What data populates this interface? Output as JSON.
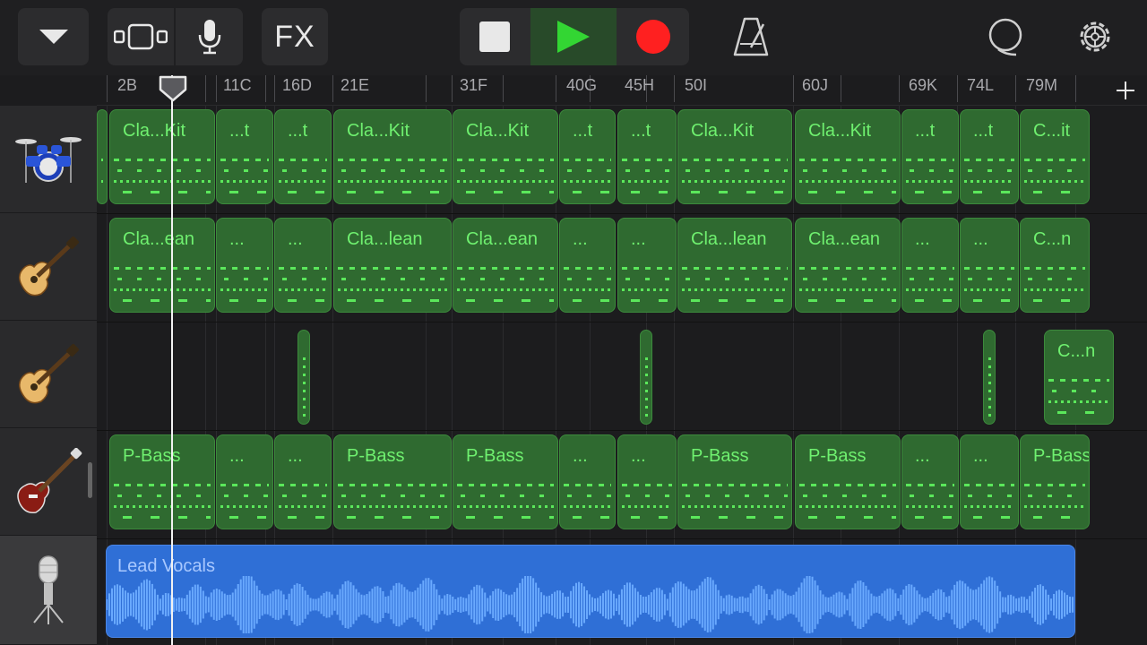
{
  "toolbar": {
    "fx_label": "FX",
    "icons": [
      "menu-down-icon",
      "tracks-view-icon",
      "microphone-icon",
      "stop-icon",
      "play-icon",
      "record-icon",
      "metronome-icon",
      "loop-browser-icon",
      "settings-gear-icon"
    ],
    "colors": {
      "play": "#33d633",
      "record": "#ff2020"
    }
  },
  "ruler": {
    "markers": [
      {
        "label": "2B"
      },
      {
        "label": "11C"
      },
      {
        "label": "16D"
      },
      {
        "label": "21E"
      },
      {
        "label": "31F"
      },
      {
        "label": "40G"
      },
      {
        "label": "45H"
      },
      {
        "label": "50I"
      },
      {
        "label": "60J"
      },
      {
        "label": "69K"
      },
      {
        "label": "74L"
      },
      {
        "label": "79M"
      }
    ]
  },
  "tracks": [
    {
      "instrument": "drum-kit-icon",
      "regions": [
        "Cla...Kit",
        "...t",
        "...t",
        "Cla...Kit",
        "Cla...Kit",
        "...t",
        "...t",
        "Cla...Kit",
        "Cla...Kit",
        "...t",
        "...t",
        "C...it"
      ]
    },
    {
      "instrument": "electric-guitar-icon",
      "regions": [
        "Cla...ean",
        "...",
        "...",
        "Cla...lean",
        "Cla...ean",
        "...",
        "...",
        "Cla...lean",
        "Cla...ean",
        "...",
        "...",
        "C...n"
      ]
    },
    {
      "instrument": "electric-guitar-icon",
      "regions": [
        "C...n"
      ]
    },
    {
      "instrument": "bass-guitar-icon",
      "regions": [
        "P-Bass",
        "...",
        "...",
        "P-Bass",
        "P-Bass",
        "...",
        "...",
        "P-Bass",
        "P-Bass",
        "...",
        "...",
        "P-Bass"
      ]
    },
    {
      "instrument": "microphone-icon",
      "regions": [
        "Lead Vocals"
      ]
    }
  ],
  "colors": {
    "midi_region": "#2f6a30",
    "midi_text": "#6ff06f",
    "audio_region": "#2f6fd6"
  }
}
